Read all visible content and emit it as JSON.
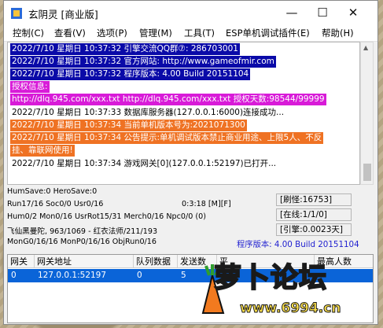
{
  "window": {
    "title": "玄阴灵 [商业版]"
  },
  "window_controls": {
    "minimize": "—",
    "maximize": "☐",
    "close": "✕"
  },
  "menu": [
    "控制(C)",
    "查看(V)",
    "选项(P)",
    "管理(M)",
    "工具(T)",
    "ESP单机调试插件(E)",
    "帮助(H)"
  ],
  "log_lines": [
    "2022/7/10 星期日 10:37:32 引擎交流QQ群⑦: 286703001",
    "2022/7/10 星期日 10:37:32 官方网站: http://www.gameofmir.com",
    "2022/7/10 星期日 10:37:32 程序版本: 4.00 Build 20151104",
    "授权信息:",
    "http://dlq.945.com/xxx.txt http://dlq.945.com/xxx.txt 授权天数:98544/99999",
    "2022/7/10 星期日 10:37:33 数据库服务器(127.0.0.1:6000)连接成功...",
    "2022/7/10 星期日 10:37:34 当前单机版本号为:2021071300",
    "2022/7/10 星期日 10:37:34 公告提示:单机调试版本禁止商业用途、上限5人、不反",
    "挂、靠联网使用!",
    "2022/7/10 星期日 10:37:34 游戏网关[0](127.0.0.1:52197)已打开..."
  ],
  "colors": {
    "blue_bg": "#0a0aa8",
    "magenta_bg": "#d81bd8",
    "orange_bg": "#ef7223",
    "selected_row": "#0a64d8",
    "version_text": "#1f1fd0"
  },
  "status": {
    "line1": "HumSave:0 HeroSave:0",
    "line2": "Run17/16 Soc0/0 Usr0/16",
    "line3": "Hum0/2 Mon0/16 UsrRot15/31 Merch0/16 Npc0/0 (0)",
    "line4": "飞仙黑曼陀, 963/1069 - 红衣法师/211/193",
    "line5": "MonG0/16/16 MonP0/16/16 ObjRun0/16",
    "time": "0:3:18 [M][F]",
    "version": "程序版本: 4.00 Build 20151104",
    "refresh": "[刷怪:16753]",
    "online": "[在线:1/1/0]",
    "engine": "[引擎:0.0023天]"
  },
  "table": {
    "headers": [
      "网关",
      "网关地址",
      "队列数据",
      "发送数",
      "平",
      "最高人数"
    ],
    "rows": [
      [
        "0",
        "127.0.0.1:52197",
        "0",
        "5",
        "",
        ""
      ]
    ]
  },
  "watermark": {
    "text": "萝卜论坛",
    "url": "www.6994.cn"
  }
}
